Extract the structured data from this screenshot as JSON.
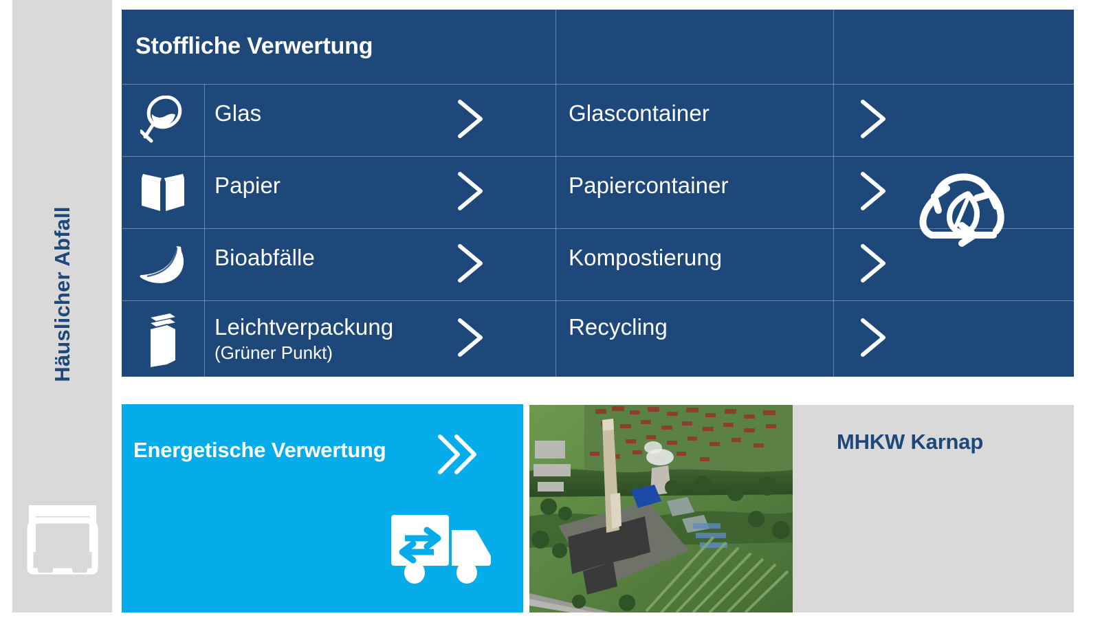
{
  "sidebar": {
    "label": "Häuslicher Abfall",
    "truck_icon": "truck-front-icon"
  },
  "material_recovery": {
    "title": "Stoffliche Verwertung",
    "recycle_icon": "recycle-leaf-icon",
    "rows": [
      {
        "icon": "wine-glass-icon",
        "material": "Glas",
        "material_sub": "",
        "arrow1": "chevron-right-icon",
        "destination": "Glascontainer",
        "arrow2": "chevron-right-icon"
      },
      {
        "icon": "open-book-icon",
        "material": "Papier",
        "material_sub": "",
        "arrow1": "chevron-right-icon",
        "destination": "Papiercontainer",
        "arrow2": "chevron-right-icon"
      },
      {
        "icon": "banana-icon",
        "material": "Bioabfälle",
        "material_sub": "",
        "arrow1": "chevron-right-icon",
        "destination": "Kompostierung",
        "arrow2": "chevron-right-icon"
      },
      {
        "icon": "milk-carton-icon",
        "material": "Leichtverpackung",
        "material_sub": "(Grüner Punkt)",
        "arrow1": "chevron-right-icon",
        "destination": "Recycling",
        "arrow2": "chevron-right-icon"
      }
    ]
  },
  "energy_recovery": {
    "title": "Energetische Verwertung",
    "double_chevron_icon": "double-chevron-right-icon",
    "truck_icon": "delivery-truck-exchange-icon"
  },
  "facility": {
    "photo_alt": "aerial-photo-waste-incineration-plant",
    "name": "MHKW Karnap"
  },
  "colors": {
    "dark_blue": "#1d4879",
    "cyan": "#04ace9",
    "light_gray": "#d9d9d9",
    "white": "#ffffff"
  }
}
